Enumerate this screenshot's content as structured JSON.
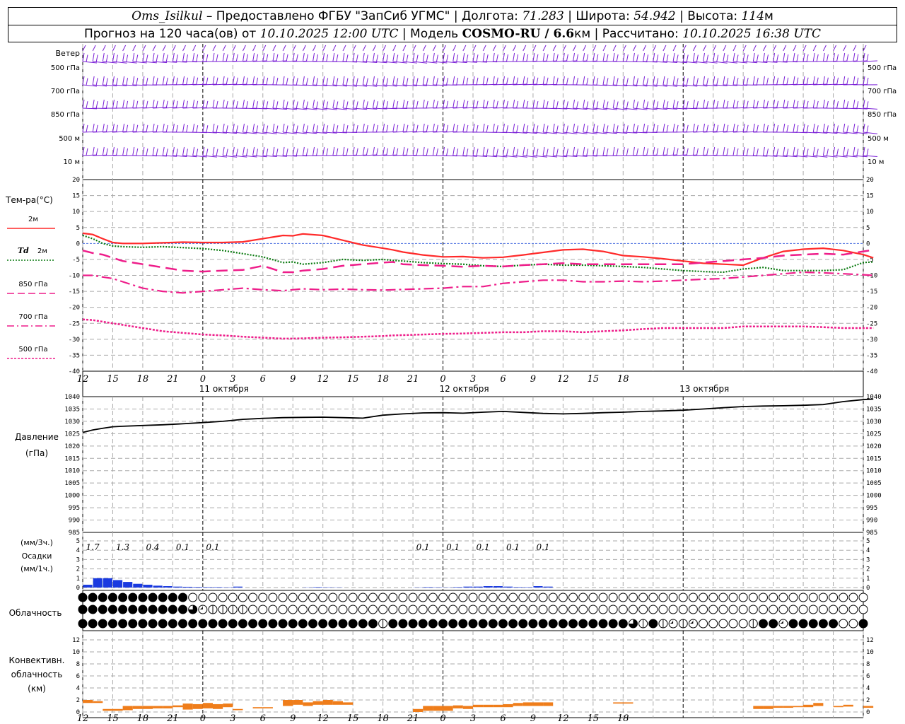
{
  "header": {
    "station": "Oms_Isilkul",
    "provider": "Предоставлено ФГБУ \"ЗапСиб УГМС\"",
    "lon_label": "Долгота:",
    "lon": "71.283",
    "lat_label": "Широта:",
    "lat": "54.942",
    "alt_label": "Высота:",
    "alt": "114",
    "alt_unit": "м",
    "forecast_label": "Прогноз на 120 часа(ов) от",
    "run_time": "10.10.2025 12:00 UTC",
    "model_label": "Модель",
    "model": "COSMO-RU / 6.6",
    "model_unit": "км",
    "computed_label": "Рассчитано:",
    "computed_time": "10.10.2025 16:38 UTC"
  },
  "axis": {
    "hour_labels": [
      "12",
      "15",
      "18",
      "21",
      "0",
      "3",
      "6",
      "9",
      "12",
      "15",
      "18",
      "21",
      "0",
      "3",
      "6",
      "9",
      "12",
      "15",
      "18"
    ],
    "date_labels": [
      {
        "text": "11 октября",
        "hour": 12
      },
      {
        "text": "12 октября",
        "hour": 36
      },
      {
        "text": "13 октября",
        "hour": 60
      }
    ],
    "midnights": [
      12,
      36,
      60
    ]
  },
  "wind_panel": {
    "row_labels": [
      "Ветер",
      "500 гПа",
      "700 гПа",
      "850 гПа",
      "500 м",
      "10 м"
    ],
    "right_labels": [
      "500 гПа",
      "700 гПа",
      "850 гПа",
      "500 м",
      "10 м"
    ],
    "color": "#7a1fd6"
  },
  "temp_panel": {
    "title": "Тем-ра(°C)",
    "legend": [
      {
        "label": "2м",
        "color": "#ff2a2a",
        "style": "solid"
      },
      {
        "label": "Td",
        "label2": "2м",
        "color": "#0a7a10",
        "style": "dotted"
      },
      {
        "label": "850 гПа",
        "color": "#ee1d8a",
        "style": "dash"
      },
      {
        "label": "700 гПа",
        "color": "#ee1d8a",
        "style": "dashdot"
      },
      {
        "label": "500 гПа",
        "color": "#ee1d8a",
        "style": "dot"
      }
    ],
    "yticks": [
      "20",
      "15",
      "10",
      "5",
      "0",
      "-5",
      "-10",
      "-15",
      "-20",
      "-25",
      "-30",
      "-35",
      "-40"
    ]
  },
  "pressure_panel": {
    "title": "Давление",
    "unit": "(гПа)",
    "yticks": [
      "1040",
      "1035",
      "1030",
      "1025",
      "1020",
      "1015",
      "1010",
      "1005",
      "1000",
      "995",
      "990",
      "985"
    ]
  },
  "precip_panel": {
    "unit_3h": "(мм/3ч.)",
    "title": "Осадки",
    "unit_1h": "(мм/1ч.)",
    "yticks": [
      "5",
      "4",
      "3",
      "2",
      "1",
      "0"
    ],
    "totals": [
      {
        "hour": 0.5,
        "text": "1.7"
      },
      {
        "hour": 3.5,
        "text": "1.3"
      },
      {
        "hour": 6.5,
        "text": "0.4"
      },
      {
        "hour": 9.5,
        "text": "0.1"
      },
      {
        "hour": 12.5,
        "text": "0.1"
      },
      {
        "hour": 33.5,
        "text": "0.1"
      },
      {
        "hour": 36.5,
        "text": "0.1"
      },
      {
        "hour": 39.5,
        "text": "0.1"
      },
      {
        "hour": 42.5,
        "text": "0.1"
      },
      {
        "hour": 45.5,
        "text": "0.1"
      }
    ]
  },
  "cloud_panel": {
    "title": "Облачность"
  },
  "conv_panel": {
    "title_line1": "Конвективн.",
    "title_line2": "облачность",
    "unit": "(км)",
    "yticks": [
      "12",
      "10",
      "8",
      "6",
      "4",
      "2",
      "0"
    ]
  },
  "chart_data": [
    {
      "type": "line",
      "title": "Тем-ра(°C)",
      "ylim": [
        -40,
        20
      ],
      "x": [
        0,
        1,
        2,
        3,
        4,
        6,
        8,
        10,
        12,
        14,
        16,
        18,
        20,
        21,
        22,
        24,
        26,
        28,
        30,
        31,
        32,
        34,
        36,
        38,
        40,
        42,
        44,
        46,
        48,
        50,
        52,
        54,
        56,
        58,
        60,
        62,
        64,
        66,
        68,
        70,
        72,
        74,
        76,
        78,
        79
      ],
      "series": [
        {
          "name": "2м",
          "values": [
            3.2,
            2.8,
            1.5,
            0.3,
            0,
            0,
            0.2,
            0.4,
            0.3,
            0.3,
            0.5,
            1.5,
            2.5,
            2.4,
            3.0,
            2.5,
            1.0,
            -0.5,
            -1.5,
            -2.0,
            -2.7,
            -3.6,
            -4.2,
            -4.1,
            -4.5,
            -4.3,
            -3.6,
            -2.8,
            -2.0,
            -1.8,
            -2.5,
            -3.8,
            -4.2,
            -4.8,
            -5.5,
            -6.2,
            -6.5,
            -6.8,
            -4.5,
            -2.5,
            -1.8,
            -1.5,
            -2.2,
            -3.5,
            -4.5
          ]
        },
        {
          "name": "Td 2м",
          "values": [
            2.5,
            1.5,
            0,
            -0.8,
            -1.0,
            -1.2,
            -1.0,
            -1.3,
            -1.6,
            -2.2,
            -3.2,
            -4.2,
            -6.0,
            -5.8,
            -6.5,
            -6.0,
            -5.0,
            -5.3,
            -5.0,
            -5.3,
            -5.5,
            -6.0,
            -6.3,
            -6.5,
            -7.0,
            -7.2,
            -6.8,
            -6.5,
            -6.8,
            -6.8,
            -7.0,
            -7.2,
            -7.5,
            -8.0,
            -8.5,
            -8.8,
            -9.0,
            -8.0,
            -7.5,
            -8.5,
            -8.5,
            -8.5,
            -8.2,
            -6.0,
            -5.8
          ]
        },
        {
          "name": "850 гПа",
          "values": [
            -2.2,
            -3.0,
            -3.5,
            -4.5,
            -5.5,
            -6.5,
            -7.5,
            -8.5,
            -8.8,
            -8.5,
            -8.3,
            -7.0,
            -9.0,
            -9.0,
            -8.5,
            -8.0,
            -7.0,
            -6.5,
            -6.0,
            -5.8,
            -6.5,
            -6.8,
            -7.0,
            -7.3,
            -7.0,
            -7.2,
            -6.8,
            -6.5,
            -6.2,
            -6.5,
            -6.5,
            -6.5,
            -6.5,
            -6.5,
            -6.5,
            -6.0,
            -5.5,
            -5.0,
            -4.5,
            -3.8,
            -3.5,
            -3.2,
            -3.5,
            -2.5,
            -2.0
          ]
        },
        {
          "name": "700 гПа",
          "values": [
            -10.0,
            -10.0,
            -10.5,
            -11.0,
            -12.0,
            -14.0,
            -15.0,
            -15.5,
            -15.0,
            -14.5,
            -14.0,
            -14.5,
            -14.8,
            -14.5,
            -14.2,
            -14.5,
            -14.3,
            -14.5,
            -14.6,
            -14.5,
            -14.4,
            -14.2,
            -14.0,
            -13.5,
            -13.5,
            -12.5,
            -12.0,
            -11.5,
            -11.5,
            -12.0,
            -12.0,
            -11.8,
            -12.0,
            -11.8,
            -11.5,
            -11.2,
            -11.0,
            -10.5,
            -10.0,
            -9.5,
            -9.0,
            -9.2,
            -9.5,
            -9.8,
            -10.0
          ]
        },
        {
          "name": "500 гПа",
          "values": [
            -23.8,
            -24.0,
            -24.5,
            -25.0,
            -25.5,
            -26.5,
            -27.5,
            -28.0,
            -28.5,
            -28.8,
            -29.2,
            -29.5,
            -29.8,
            -29.8,
            -29.7,
            -29.5,
            -29.4,
            -29.2,
            -29.0,
            -28.8,
            -28.7,
            -28.5,
            -28.3,
            -28.2,
            -28.0,
            -27.8,
            -27.8,
            -27.5,
            -27.5,
            -27.8,
            -27.5,
            -27.2,
            -26.8,
            -26.5,
            -26.5,
            -26.5,
            -26.5,
            -26.0,
            -26.0,
            -26.0,
            -26.0,
            -26.2,
            -26.5,
            -26.5,
            -26.5
          ]
        }
      ]
    },
    {
      "type": "line",
      "title": "Давление",
      "ylim": [
        985,
        1040
      ],
      "x": [
        0,
        1,
        2,
        3,
        4,
        6,
        8,
        10,
        12,
        14,
        16,
        18,
        20,
        22,
        24,
        26,
        28,
        30,
        32,
        34,
        36,
        38,
        40,
        42,
        44,
        46,
        48,
        50,
        52,
        54,
        56,
        58,
        60,
        62,
        64,
        66,
        68,
        70,
        72,
        74,
        76,
        78,
        79
      ],
      "series": [
        {
          "name": "Давление",
          "values": [
            1025.5,
            1026.5,
            1027.2,
            1027.8,
            1028.0,
            1028.3,
            1028.6,
            1029.0,
            1029.5,
            1030.0,
            1030.8,
            1031.2,
            1031.5,
            1031.6,
            1031.7,
            1031.5,
            1031.3,
            1032.5,
            1033.0,
            1033.4,
            1033.5,
            1033.3,
            1033.7,
            1034.0,
            1033.6,
            1033.2,
            1033.0,
            1033.2,
            1033.5,
            1033.7,
            1034.0,
            1034.2,
            1034.5,
            1035.0,
            1035.5,
            1036.0,
            1036.2,
            1036.3,
            1036.5,
            1036.8,
            1038.0,
            1038.8,
            1039.0
          ]
        }
      ]
    },
    {
      "type": "bar",
      "title": "Осадки",
      "ylim": [
        0,
        5
      ],
      "x": [
        0,
        1,
        2,
        3,
        4,
        5,
        6,
        7,
        8,
        9,
        10,
        11,
        12,
        13,
        14,
        15,
        22,
        23,
        24,
        25,
        33,
        34,
        35,
        36,
        37,
        38,
        39,
        40,
        41,
        42,
        43,
        44,
        45,
        46
      ],
      "series": [
        {
          "name": "мм/1ч",
          "values": [
            0.3,
            1.0,
            1.0,
            0.8,
            0.6,
            0.4,
            0.3,
            0.2,
            0.15,
            0.1,
            0.08,
            0.06,
            0.05,
            0.05,
            0.03,
            0.1,
            0.02,
            0.05,
            0.03,
            0.02,
            0.02,
            0.05,
            0.03,
            0.02,
            0.05,
            0.1,
            0.1,
            0.15,
            0.15,
            0.1,
            0.05,
            0.04,
            0.15,
            0.1
          ]
        },
        {
          "name": "конвективные",
          "values": [
            0,
            0.7,
            0.3,
            0,
            0,
            0,
            0,
            0,
            0,
            0,
            0,
            0,
            0,
            0,
            0,
            0,
            0,
            0,
            0,
            0,
            0,
            0,
            0,
            0,
            0,
            0,
            0,
            0,
            0,
            0,
            0,
            0,
            0,
            0
          ]
        }
      ]
    },
    {
      "type": "bar",
      "title": "Конвективн. облачность",
      "ylim": [
        0,
        13
      ],
      "x": [
        0,
        1,
        2,
        3,
        4,
        5,
        6,
        7,
        8,
        9,
        10,
        11,
        12,
        13,
        14,
        15,
        17,
        18,
        20,
        21,
        22,
        23,
        24,
        25,
        26,
        33,
        34,
        35,
        36,
        37,
        38,
        39,
        40,
        41,
        42,
        43,
        44,
        45,
        46,
        53,
        54,
        67,
        68,
        69,
        70,
        71,
        72,
        73,
        75,
        76,
        78
      ],
      "series": [
        {
          "name": "низ",
          "values": [
            1.5,
            1.5,
            0.2,
            0.2,
            0.3,
            0.5,
            0.5,
            0.6,
            0.6,
            0.8,
            0.4,
            0.5,
            0.6,
            0.5,
            0.8,
            0.3,
            0.6,
            0.6,
            1.0,
            1.2,
            1.0,
            1.2,
            1.2,
            1.2,
            1.2,
            0,
            0.2,
            0.2,
            0.2,
            0.6,
            0.5,
            0.8,
            0.8,
            0.8,
            0.8,
            1.0,
            1.0,
            1.0,
            1.0,
            1.4,
            1.4,
            0.5,
            0.5,
            0.7,
            0.7,
            0.8,
            0.8,
            1.0,
            0.8,
            0.9,
            0.7
          ]
        },
        {
          "name": "верх",
          "values": [
            2.0,
            1.8,
            0.5,
            0.5,
            1.0,
            1.0,
            1.0,
            1.0,
            1.0,
            1.1,
            1.4,
            1.3,
            1.5,
            1.3,
            1.4,
            0.5,
            0.8,
            0.8,
            2.0,
            2.0,
            1.6,
            1.8,
            2.0,
            1.8,
            1.6,
            0.5,
            1.0,
            1.0,
            1.0,
            1.1,
            1.0,
            1.2,
            1.2,
            1.2,
            1.3,
            1.5,
            1.6,
            1.6,
            1.6,
            1.6,
            1.6,
            1.0,
            1.0,
            1.0,
            1.0,
            1.0,
            1.2,
            1.5,
            1.0,
            1.2,
            1.0
          ]
        }
      ]
    }
  ]
}
